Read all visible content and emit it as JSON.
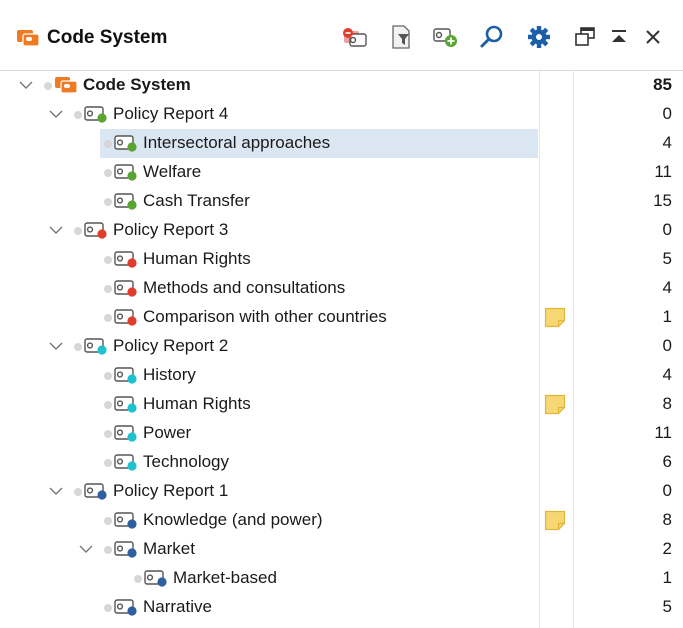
{
  "header": {
    "title": "Code System"
  },
  "toolbar": [
    {
      "name": "activate-codes-icon"
    },
    {
      "name": "filter-icon"
    },
    {
      "name": "new-code-icon"
    },
    {
      "name": "search-icon"
    },
    {
      "name": "settings-gear-icon"
    },
    {
      "name": "undock-window-icon"
    },
    {
      "name": "collapse-panel-icon"
    },
    {
      "name": "close-icon"
    }
  ],
  "colors": {
    "green": "#5aa532",
    "red": "#e03c2c",
    "cyan": "#1fc1d0",
    "blue": "#2f5f9e",
    "orange": "#f07a22",
    "selection": "#dbe6f3",
    "memo": "#f7d774"
  },
  "tree": [
    {
      "label": "Code System",
      "count": "85",
      "level": 0,
      "chevron": true,
      "root": true
    },
    {
      "label": "Policy Report 4",
      "count": "0",
      "level": 1,
      "chevron": true,
      "color": "green"
    },
    {
      "label": "Intersectoral approaches",
      "count": "4",
      "level": 2,
      "color": "green",
      "selected": true
    },
    {
      "label": "Welfare",
      "count": "11",
      "level": 2,
      "color": "green"
    },
    {
      "label": "Cash Transfer",
      "count": "15",
      "level": 2,
      "color": "green"
    },
    {
      "label": "Policy Report 3",
      "count": "0",
      "level": 1,
      "chevron": true,
      "color": "red"
    },
    {
      "label": "Human Rights",
      "count": "5",
      "level": 2,
      "color": "red"
    },
    {
      "label": "Methods and consultations",
      "count": "4",
      "level": 2,
      "color": "red"
    },
    {
      "label": "Comparison with other countries",
      "count": "1",
      "level": 2,
      "color": "red",
      "memo": true
    },
    {
      "label": "Policy Report 2",
      "count": "0",
      "level": 1,
      "chevron": true,
      "color": "cyan"
    },
    {
      "label": "History",
      "count": "4",
      "level": 2,
      "color": "cyan"
    },
    {
      "label": "Human Rights",
      "count": "8",
      "level": 2,
      "color": "cyan",
      "memo": true
    },
    {
      "label": "Power",
      "count": "11",
      "level": 2,
      "color": "cyan"
    },
    {
      "label": "Technology",
      "count": "6",
      "level": 2,
      "color": "cyan"
    },
    {
      "label": "Policy Report 1",
      "count": "0",
      "level": 1,
      "chevron": true,
      "color": "blue"
    },
    {
      "label": "Knowledge (and power)",
      "count": "8",
      "level": 2,
      "color": "blue",
      "memo": true
    },
    {
      "label": "Market",
      "count": "2",
      "level": 2,
      "chevron": true,
      "color": "blue"
    },
    {
      "label": "Market-based",
      "count": "1",
      "level": 3,
      "color": "blue"
    },
    {
      "label": "Narrative",
      "count": "5",
      "level": 2,
      "color": "blue"
    }
  ]
}
